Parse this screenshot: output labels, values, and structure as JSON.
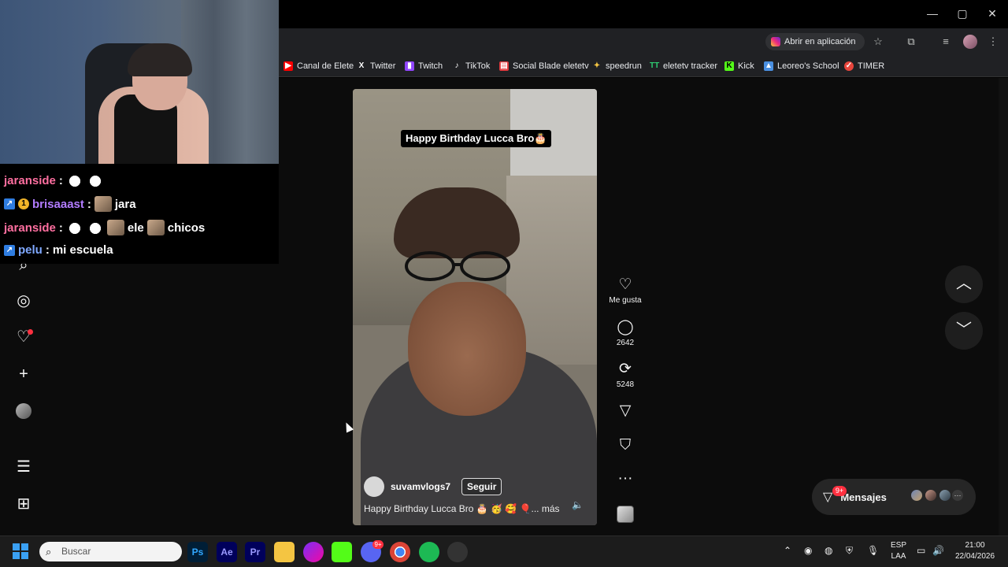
{
  "window": {
    "minimize": "—",
    "maximize": "▢",
    "close": "✕"
  },
  "toolbar": {
    "open_in_app": "Abrir en aplicación"
  },
  "bookmarks": [
    {
      "label": "Canal de Elete",
      "icon": "youtube-icon",
      "color": "#ff0000"
    },
    {
      "label": "Twitter",
      "icon": "x-icon",
      "color": "#ffffff"
    },
    {
      "label": "Twitch",
      "icon": "twitch-icon",
      "color": "#9146ff"
    },
    {
      "label": "TikTok",
      "icon": "tiktok-icon",
      "color": "#ffffff"
    },
    {
      "label": "Social Blade eletetv",
      "icon": "socialblade-icon",
      "color": "#e03a3e"
    },
    {
      "label": "speedrun",
      "icon": "speedrun-icon",
      "color": "#f5c542"
    },
    {
      "label": "eletetv tracker",
      "icon": "tracker-icon",
      "color": "#2ecc71"
    },
    {
      "label": "Kick",
      "icon": "kick-icon",
      "color": "#53fc18"
    },
    {
      "label": "Leoreo's School",
      "icon": "school-icon",
      "color": "#4a90e2"
    },
    {
      "label": "TIMER",
      "icon": "timer-icon",
      "color": "#e8453c"
    }
  ],
  "reel": {
    "overlay_title": "Happy Birthday Lucca Bro🎂",
    "username": "suvamvlogs7",
    "follow": "Seguir",
    "description": "Happy Birthday Lucca Bro 🎂 🥳 🥰 🎈... más"
  },
  "actions": {
    "like_label": "Me gusta",
    "comments_count": "2642",
    "reposts_count": "5248"
  },
  "messages": {
    "label": "Mensajes",
    "badge": "9+"
  },
  "chat": [
    {
      "user": "jaranside",
      "color": "#ff6fa0",
      "text": ""
    },
    {
      "user": "brisaaast",
      "color": "#b27cff",
      "text": "jara"
    },
    {
      "user": "jaranside",
      "color": "#ff6fa0",
      "text_a": "ele",
      "text_b": "chicos"
    },
    {
      "user": "pelu",
      "color": "#7fa8ff",
      "text": "mi escuela"
    }
  ],
  "taskbar": {
    "search_placeholder": "Buscar",
    "apps": [
      "Ps",
      "Ae",
      "Pr"
    ],
    "discord_badge": "9+",
    "lang_top": "ESP",
    "lang_bottom": "LAA",
    "time": "21:00",
    "date": "22/04/2026"
  },
  "colors": {
    "accent": "#ff3040",
    "background": "#0c0c0c",
    "chrome": "#202124"
  }
}
